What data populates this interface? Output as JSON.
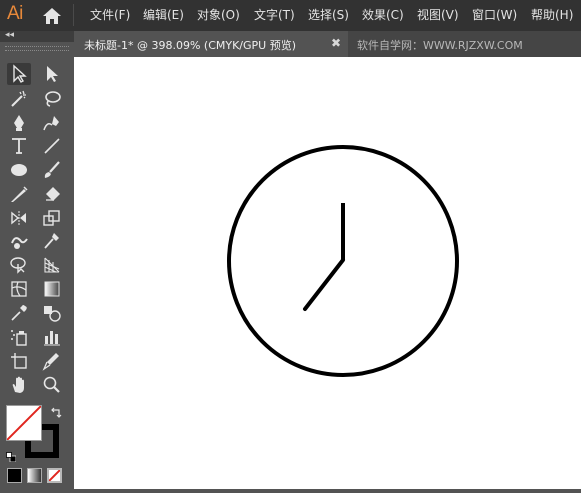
{
  "app": {
    "logo_text": "Ai",
    "accent": "#e8893a"
  },
  "menu": {
    "items": [
      "文件(F)",
      "编辑(E)",
      "对象(O)",
      "文字(T)",
      "选择(S)",
      "效果(C)",
      "视图(V)",
      "窗口(W)",
      "帮助(H)"
    ]
  },
  "tabs": {
    "active_label": "未标题-1* @ 398.09% (CMYK/GPU 预览)",
    "close_glyph": "✖",
    "second_label": "软件自学网：WWW.RJZXW.COM"
  },
  "toolbar": {
    "collapse_glyph": "◂◂",
    "tools": [
      {
        "name": "selection-tool-icon",
        "selected": true
      },
      {
        "name": "direct-selection-tool-icon"
      },
      {
        "name": "magic-wand-tool-icon"
      },
      {
        "name": "lasso-tool-icon"
      },
      {
        "name": "pen-tool-icon"
      },
      {
        "name": "curvature-tool-icon"
      },
      {
        "name": "type-tool-icon"
      },
      {
        "name": "line-segment-tool-icon"
      },
      {
        "name": "ellipse-tool-icon"
      },
      {
        "name": "paintbrush-tool-icon"
      },
      {
        "name": "shaper-tool-icon"
      },
      {
        "name": "eraser-tool-icon"
      },
      {
        "name": "rotate-tool-icon"
      },
      {
        "name": "scale-tool-icon"
      },
      {
        "name": "warp-tool-icon"
      },
      {
        "name": "puppet-warp-tool-icon"
      },
      {
        "name": "shape-builder-tool-icon"
      },
      {
        "name": "perspective-grid-tool-icon"
      },
      {
        "name": "mesh-tool-icon"
      },
      {
        "name": "gradient-tool-icon"
      },
      {
        "name": "eyedropper-tool-icon"
      },
      {
        "name": "blend-tool-icon"
      },
      {
        "name": "symbol-sprayer-tool-icon"
      },
      {
        "name": "column-graph-tool-icon"
      },
      {
        "name": "artboard-tool-icon"
      },
      {
        "name": "slice-tool-icon"
      },
      {
        "name": "hand-tool-icon"
      },
      {
        "name": "zoom-tool-icon"
      }
    ],
    "fill_color": "#ffffff",
    "stroke_color": "#000000",
    "none_color": "#e0261f"
  },
  "artwork": {
    "shape": "clock-face",
    "stroke_color": "#000000"
  }
}
